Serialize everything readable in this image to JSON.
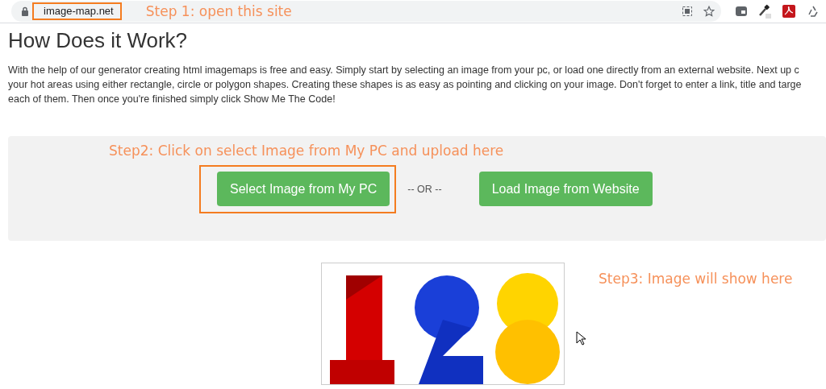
{
  "browser": {
    "url": "image-map.net",
    "note": "Step 1: open this site"
  },
  "heading": "How Does it Work?",
  "intro_lines": [
    "With the help of our generator creating html imagemaps is free and easy. Simply start by selecting an image from your pc, or load one directly from an external website. Next up c",
    "your hot areas using either rectangle, circle or polygon shapes. Creating these shapes is as easy as pointing and clicking on your image. Don't forget to enter a link, title and targe",
    "each of them. Then once you're finished simply click Show Me The Code!"
  ],
  "upload_panel": {
    "note": "Step2: Click on select Image from My PC and upload here",
    "buttons": [
      {
        "label": "Select Image from My PC",
        "highlighted": true
      },
      {
        "label": "Load Image from Website",
        "highlighted": false
      }
    ],
    "separator": "-- OR --"
  },
  "preview": {
    "note": "Step3: Image will show here"
  }
}
